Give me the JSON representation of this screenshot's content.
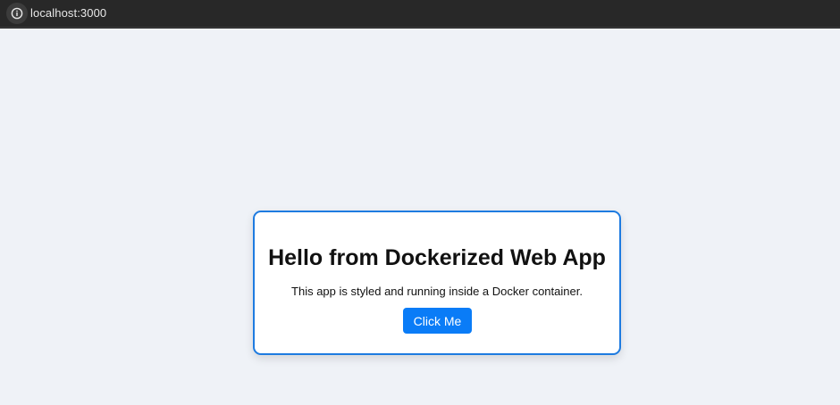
{
  "browser": {
    "url": "localhost:3000",
    "info_icon": "info-icon"
  },
  "card": {
    "title": "Hello from Dockerized Web App",
    "description": "This app is styled and running inside a Docker container.",
    "button_label": "Click Me"
  },
  "colors": {
    "page_background": "#eff2f7",
    "card_border": "#1e7be0",
    "button_background": "#0a7cf7",
    "address_bar": "#282828"
  }
}
